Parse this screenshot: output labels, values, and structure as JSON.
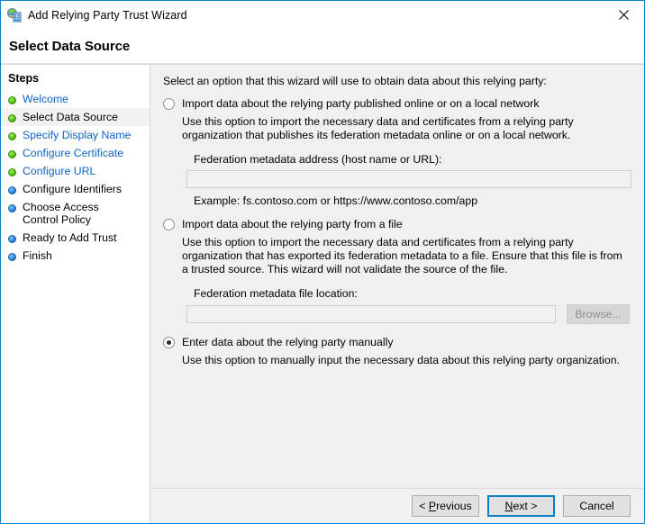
{
  "window": {
    "title": "Add Relying Party Trust Wizard",
    "icon": "adfs-relying-party-icon",
    "close_label": "×",
    "accent_color": "#0d7fc4"
  },
  "header": {
    "page_title": "Select Data Source"
  },
  "sidebar": {
    "heading": "Steps",
    "items": [
      {
        "label": "Welcome",
        "bullet": "green",
        "state": "visited"
      },
      {
        "label": "Select Data Source",
        "bullet": "green",
        "state": "current"
      },
      {
        "label": "Specify Display Name",
        "bullet": "green",
        "state": "visited"
      },
      {
        "label": "Configure Certificate",
        "bullet": "green",
        "state": "visited"
      },
      {
        "label": "Configure URL",
        "bullet": "green",
        "state": "visited"
      },
      {
        "label": "Configure Identifiers",
        "bullet": "blue",
        "state": "pending"
      },
      {
        "label": "Choose Access Control Policy",
        "bullet": "blue",
        "state": "pending"
      },
      {
        "label": "Ready to Add Trust",
        "bullet": "blue",
        "state": "pending"
      },
      {
        "label": "Finish",
        "bullet": "blue",
        "state": "pending"
      }
    ]
  },
  "main": {
    "intro": "Select an option that this wizard will use to obtain data about this relying party:",
    "options": [
      {
        "title": "Import data about the relying party published online or on a local network",
        "description": "Use this option to import the necessary data and certificates from a relying party organization that publishes its federation metadata online or on a local network.",
        "selected": false,
        "field_label": "Federation metadata address (host name or URL):",
        "field_value": "",
        "field_placeholder": "",
        "field_enabled": false,
        "example": "Example: fs.contoso.com or https://www.contoso.com/app"
      },
      {
        "title": "Import data about the relying party from a file",
        "description": "Use this option to import the necessary data and certificates from a relying party organization that has exported its federation metadata to a file. Ensure that this file is from a trusted source.  This wizard will not validate the source of the file.",
        "selected": false,
        "field_label": "Federation metadata file location:",
        "field_value": "",
        "field_placeholder": "",
        "field_enabled": false,
        "browse_label": "Browse...",
        "browse_enabled": false
      },
      {
        "title": "Enter data about the relying party manually",
        "description": "Use this option to manually input the necessary data about this relying party organization.",
        "selected": true
      }
    ]
  },
  "footer": {
    "previous": {
      "prefix": "< ",
      "mnemonic": "P",
      "rest": "revious"
    },
    "next": {
      "prefix": "",
      "mnemonic": "N",
      "rest": "ext >"
    },
    "cancel": {
      "label": "Cancel"
    }
  }
}
